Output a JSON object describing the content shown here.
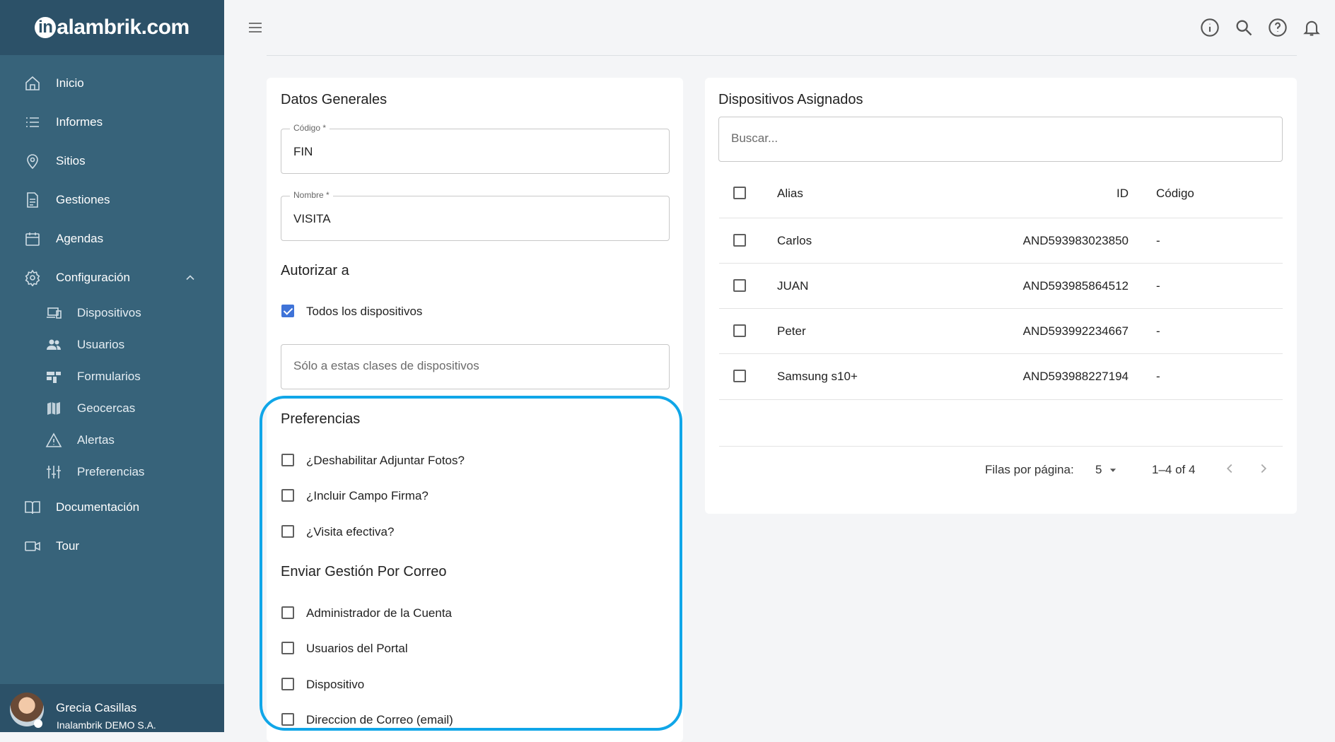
{
  "app": {
    "logo_text": "alambrik.com",
    "logo_letter": "in"
  },
  "sidebar": {
    "items": [
      {
        "label": "Inicio",
        "icon": "home-icon"
      },
      {
        "label": "Informes",
        "icon": "list-icon"
      },
      {
        "label": "Sitios",
        "icon": "location-pin-icon"
      },
      {
        "label": "Gestiones",
        "icon": "document-icon"
      },
      {
        "label": "Agendas",
        "icon": "calendar-icon"
      },
      {
        "label": "Configuración",
        "icon": "gear-icon",
        "expanded": true
      }
    ],
    "sub_items": [
      {
        "label": "Dispositivos",
        "icon": "devices-icon"
      },
      {
        "label": "Usuarios",
        "icon": "users-icon"
      },
      {
        "label": "Formularios",
        "icon": "forms-icon"
      },
      {
        "label": "Geocercas",
        "icon": "map-icon"
      },
      {
        "label": "Alertas",
        "icon": "warning-icon"
      },
      {
        "label": "Preferencias",
        "icon": "sliders-icon"
      }
    ],
    "bottom_items": [
      {
        "label": "Documentación",
        "icon": "book-icon"
      },
      {
        "label": "Tour",
        "icon": "video-icon"
      }
    ],
    "user": {
      "name": "Grecia Casillas",
      "org": "Inalambrik DEMO S.A."
    }
  },
  "topbar": {
    "icons": [
      "info-icon",
      "search-icon",
      "help-icon",
      "bell-icon"
    ]
  },
  "general": {
    "title": "Datos Generales",
    "codigo_label": "Código *",
    "codigo_value": "FIN",
    "nombre_label": "Nombre *",
    "nombre_value": "VISITA",
    "autorizar_title": "Autorizar a",
    "todos_label": "Todos los dispositivos",
    "todos_checked": true,
    "clases_placeholder": "Sólo a estas clases de dispositivos"
  },
  "preferencias": {
    "title": "Preferencias",
    "options": [
      {
        "label": "¿Deshabilitar Adjuntar Fotos?",
        "checked": false
      },
      {
        "label": "¿Incluir Campo Firma?",
        "checked": false
      },
      {
        "label": "¿Visita efectiva?",
        "checked": false
      }
    ]
  },
  "correo": {
    "title": "Enviar Gestión Por Correo",
    "options": [
      {
        "label": "Administrador de la Cuenta",
        "checked": false
      },
      {
        "label": "Usuarios del Portal",
        "checked": false
      },
      {
        "label": "Dispositivo",
        "checked": false
      },
      {
        "label": "Direccion de Correo (email)",
        "checked": false
      }
    ]
  },
  "devices": {
    "title": "Dispositivos Asignados",
    "search_placeholder": "Buscar...",
    "columns": {
      "alias": "Alias",
      "id": "ID",
      "codigo": "Código"
    },
    "rows": [
      {
        "alias": "Carlos",
        "id": "AND593983023850",
        "codigo": "-"
      },
      {
        "alias": "JUAN",
        "id": "AND593985864512",
        "codigo": "-"
      },
      {
        "alias": "Peter",
        "id": "AND593992234667",
        "codigo": "-"
      },
      {
        "alias": "Samsung s10+",
        "id": "AND593988227194",
        "codigo": "-"
      }
    ],
    "pagination": {
      "rows_label": "Filas por página:",
      "rows_value": "5",
      "range": "1–4 of 4"
    }
  }
}
